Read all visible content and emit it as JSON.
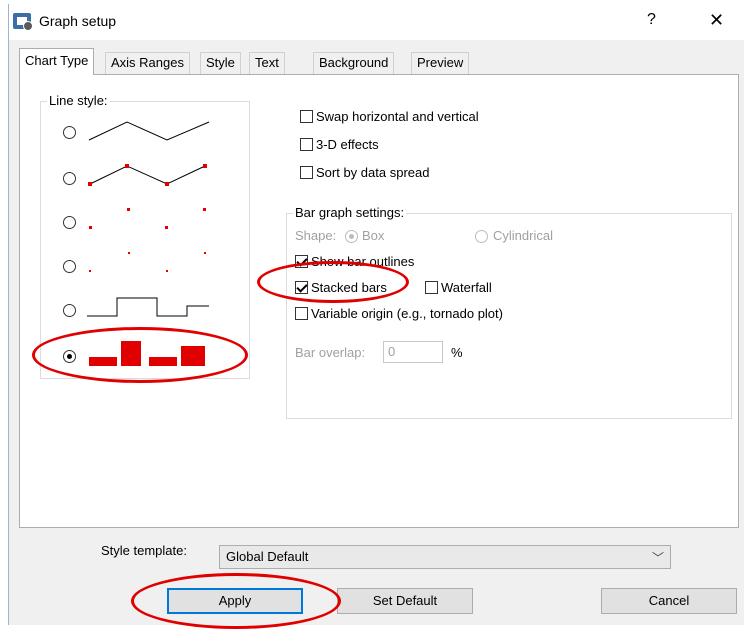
{
  "window": {
    "title": "Graph setup",
    "help_label": "?",
    "close_label": "✕"
  },
  "tabs": [
    "Chart Type",
    "Axis Ranges",
    "Style",
    "Text",
    "Background",
    "Preview"
  ],
  "line_style": {
    "label": "Line style:",
    "options": [
      {
        "name": "line",
        "selected": false
      },
      {
        "name": "line-with-points",
        "selected": false
      },
      {
        "name": "points",
        "selected": false
      },
      {
        "name": "small-points",
        "selected": false
      },
      {
        "name": "step",
        "selected": false
      },
      {
        "name": "bars",
        "selected": true
      }
    ]
  },
  "options": {
    "swap": {
      "label": "Swap horizontal and vertical",
      "checked": false
    },
    "effects3d": {
      "label": "3-D effects",
      "checked": false
    },
    "sort": {
      "label": "Sort by data spread",
      "checked": false
    }
  },
  "bar_settings": {
    "label": "Bar graph settings:",
    "shape_label": "Shape:",
    "shape_box": "Box",
    "shape_cyl": "Cylindrical",
    "show_outlines": "Show bar outlines",
    "stacked": "Stacked bars",
    "waterfall": "Waterfall",
    "variable_origin": "Variable origin (e.g., tornado plot)",
    "overlap_label": "Bar overlap:",
    "overlap_value": "0",
    "overlap_unit": "%"
  },
  "style_template": {
    "label": "Style template:",
    "value": "Global Default"
  },
  "buttons": {
    "apply": "Apply",
    "set_default": "Set Default",
    "cancel": "Cancel"
  },
  "colors": {
    "point_color": "#e00000",
    "annotation": "#e00000",
    "focus": "#0078d7"
  }
}
